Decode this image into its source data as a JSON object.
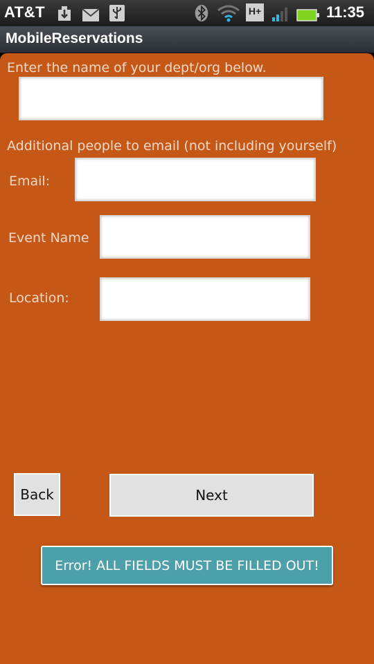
{
  "status_bar": {
    "carrier": "AT&T",
    "time": "11:35",
    "network_type": "H+",
    "icons": [
      "download-icon",
      "mail-icon",
      "usb-icon",
      "bluetooth-icon",
      "wifi-icon",
      "network-h-plus-icon",
      "signal-icon",
      "battery-icon"
    ]
  },
  "app": {
    "title": "MobileReservations"
  },
  "form": {
    "dept_label": "Enter the name of your dept/org below.",
    "dept_value": "",
    "additional_label": "Additional people to email (not including yourself)",
    "email_label": "Email:",
    "email_value": "",
    "event_label": "Event Name",
    "event_value": "",
    "location_label": "Location:",
    "location_value": ""
  },
  "buttons": {
    "back": "Back",
    "next": "Next",
    "error": "Error! ALL FIELDS MUST BE FILLED OUT!"
  },
  "colors": {
    "background": "#c65817",
    "label_text": "#f1d9c8",
    "error_button": "#4d9fa9",
    "button": "#e1e1e1",
    "battery": "#7ed321",
    "wifi": "#33b5e5"
  }
}
